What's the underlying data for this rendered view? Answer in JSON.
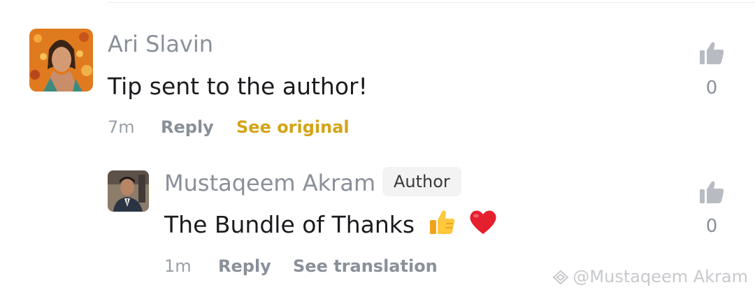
{
  "comments": [
    {
      "author": "Ari Slavin",
      "text": "Tip sent to the author!",
      "time": "7m",
      "reply_label": "Reply",
      "secondary_action": "See original",
      "likes": "0"
    },
    {
      "author": "Mustaqeem Akram",
      "badge": "Author",
      "text": "The Bundle of Thanks",
      "emojis": [
        "thumbs-up-emoji",
        "red-heart-emoji"
      ],
      "time": "1m",
      "reply_label": "Reply",
      "secondary_action": "See translation",
      "likes": "0"
    }
  ],
  "watermark": "@Mustaqeem Akram",
  "colors": {
    "name_gray": "#8a9099",
    "see_original_gold": "#d4a317",
    "badge_bg": "#f3f3f3",
    "icon_gray": "#b8bcc2"
  },
  "icons": [
    "thumbs-up-icon",
    "watermark-logo-icon"
  ]
}
